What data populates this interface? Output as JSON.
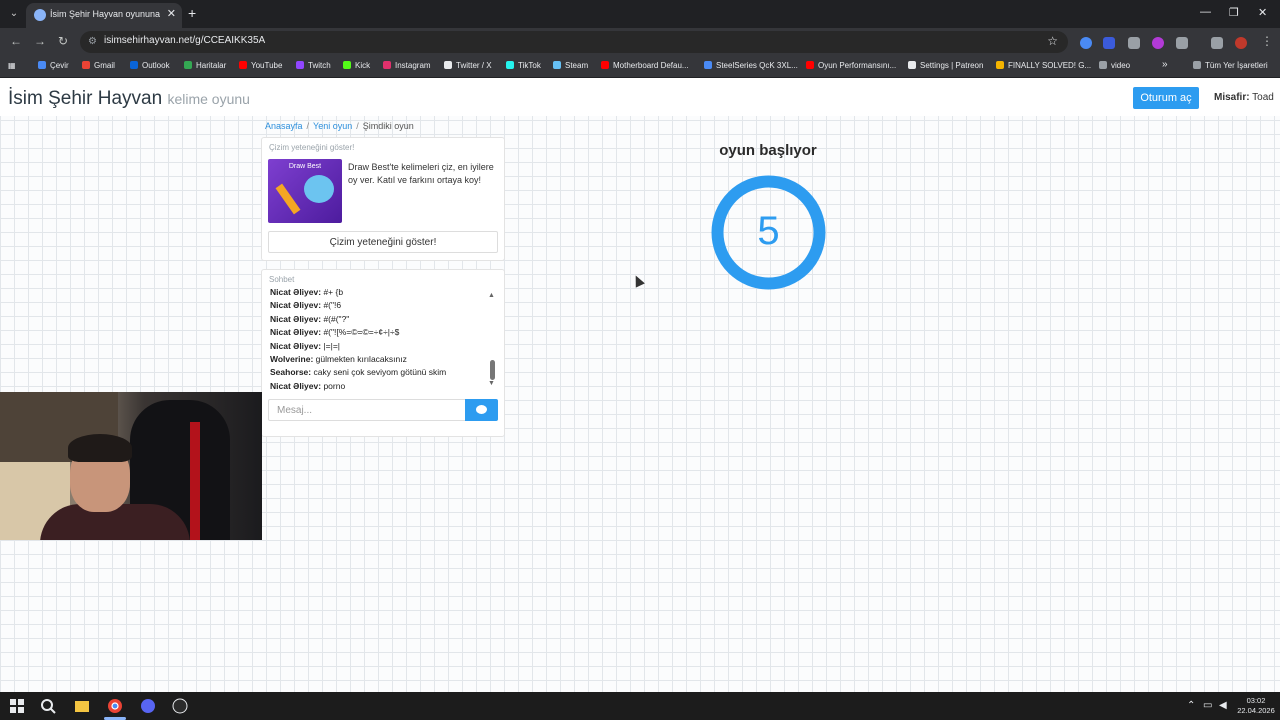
{
  "browser": {
    "tab_title": "İsim Şehir Hayvan oyununa katıl",
    "tab_close": "✕",
    "new_tab": "+",
    "url": "isimsehirhayvan.net/g/CCEAIKK35A",
    "window_controls": [
      "—",
      "❐",
      "✕"
    ],
    "bookmarks": [
      {
        "label": "Çevir",
        "color": "#4a8af4"
      },
      {
        "label": "Gmail",
        "color": "#ea4335"
      },
      {
        "label": "Outlook",
        "color": "#0a64d6"
      },
      {
        "label": "Haritalar",
        "color": "#34a853"
      },
      {
        "label": "YouTube",
        "color": "#ff0000"
      },
      {
        "label": "Twitch",
        "color": "#9146ff"
      },
      {
        "label": "Kick",
        "color": "#53fc18"
      },
      {
        "label": "Instagram",
        "color": "#e1306c"
      },
      {
        "label": "Twitter / X",
        "color": "#e8eaed"
      },
      {
        "label": "TikTok",
        "color": "#25f4ee"
      },
      {
        "label": "Steam",
        "color": "#66c0f4"
      },
      {
        "label": "Motherboard Defau...",
        "color": "#ff0000"
      },
      {
        "label": "SteelSeries QcK 3XL...",
        "color": "#4a8af4"
      },
      {
        "label": "Oyun Performansını...",
        "color": "#ff0000"
      },
      {
        "label": "Settings | Patreon",
        "color": "#e8eaed"
      },
      {
        "label": "FINALLY SOLVED! G...",
        "color": "#f4b400"
      },
      {
        "label": "video",
        "color": "#9aa0a6"
      }
    ],
    "more_bookmarks": "»",
    "all_bookmarks": "Tüm Yer İşaretleri"
  },
  "site": {
    "logo_main": "İsim Şehir Hayvan",
    "logo_sub": "kelime oyunu",
    "login_label": "Oturum aç",
    "guest_label": "Misafir:",
    "guest_name": "Toad",
    "accent": "#2d9cf0"
  },
  "breadcrumb": {
    "home": "Anasayfa",
    "new_game": "Yeni oyun",
    "current": "Şimdiki oyun",
    "sep": "/"
  },
  "promo": {
    "title": "Çizim yeteneğini göster!",
    "image_label": "Draw Best",
    "text": "Draw Best'te kelimeleri çiz, en iyilere oy ver. Katıl ve farkını ortaya koy!",
    "button": "Çizim yeteneğini göster!"
  },
  "chat": {
    "title": "Sohbet",
    "messages": [
      {
        "author": "Nicat Əliyev:",
        "text": "#+ {b"
      },
      {
        "author": "Nicat Əliyev:",
        "text": "#(\"!6"
      },
      {
        "author": "Nicat Əliyev:",
        "text": "#(#(\"?\""
      },
      {
        "author": "Nicat Əliyev:",
        "text": "#(\"![%=©=©=÷¢÷|÷$"
      },
      {
        "author": "Nicat Əliyev:",
        "text": "|=|=|"
      },
      {
        "author": "Wolverine:",
        "text": "gülmekten kırılacaksınız"
      },
      {
        "author": "Seahorse:",
        "text": "caky seni çok seviyom götünü skim"
      },
      {
        "author": "Nicat Əliyev:",
        "text": "porno"
      }
    ],
    "placeholder": "Mesaj..."
  },
  "game": {
    "status": "oyun başlıyor",
    "countdown": "5",
    "ring_color": "#2d9cf0"
  },
  "taskbar": {
    "time": "03:02",
    "date": "22.04.2026"
  }
}
